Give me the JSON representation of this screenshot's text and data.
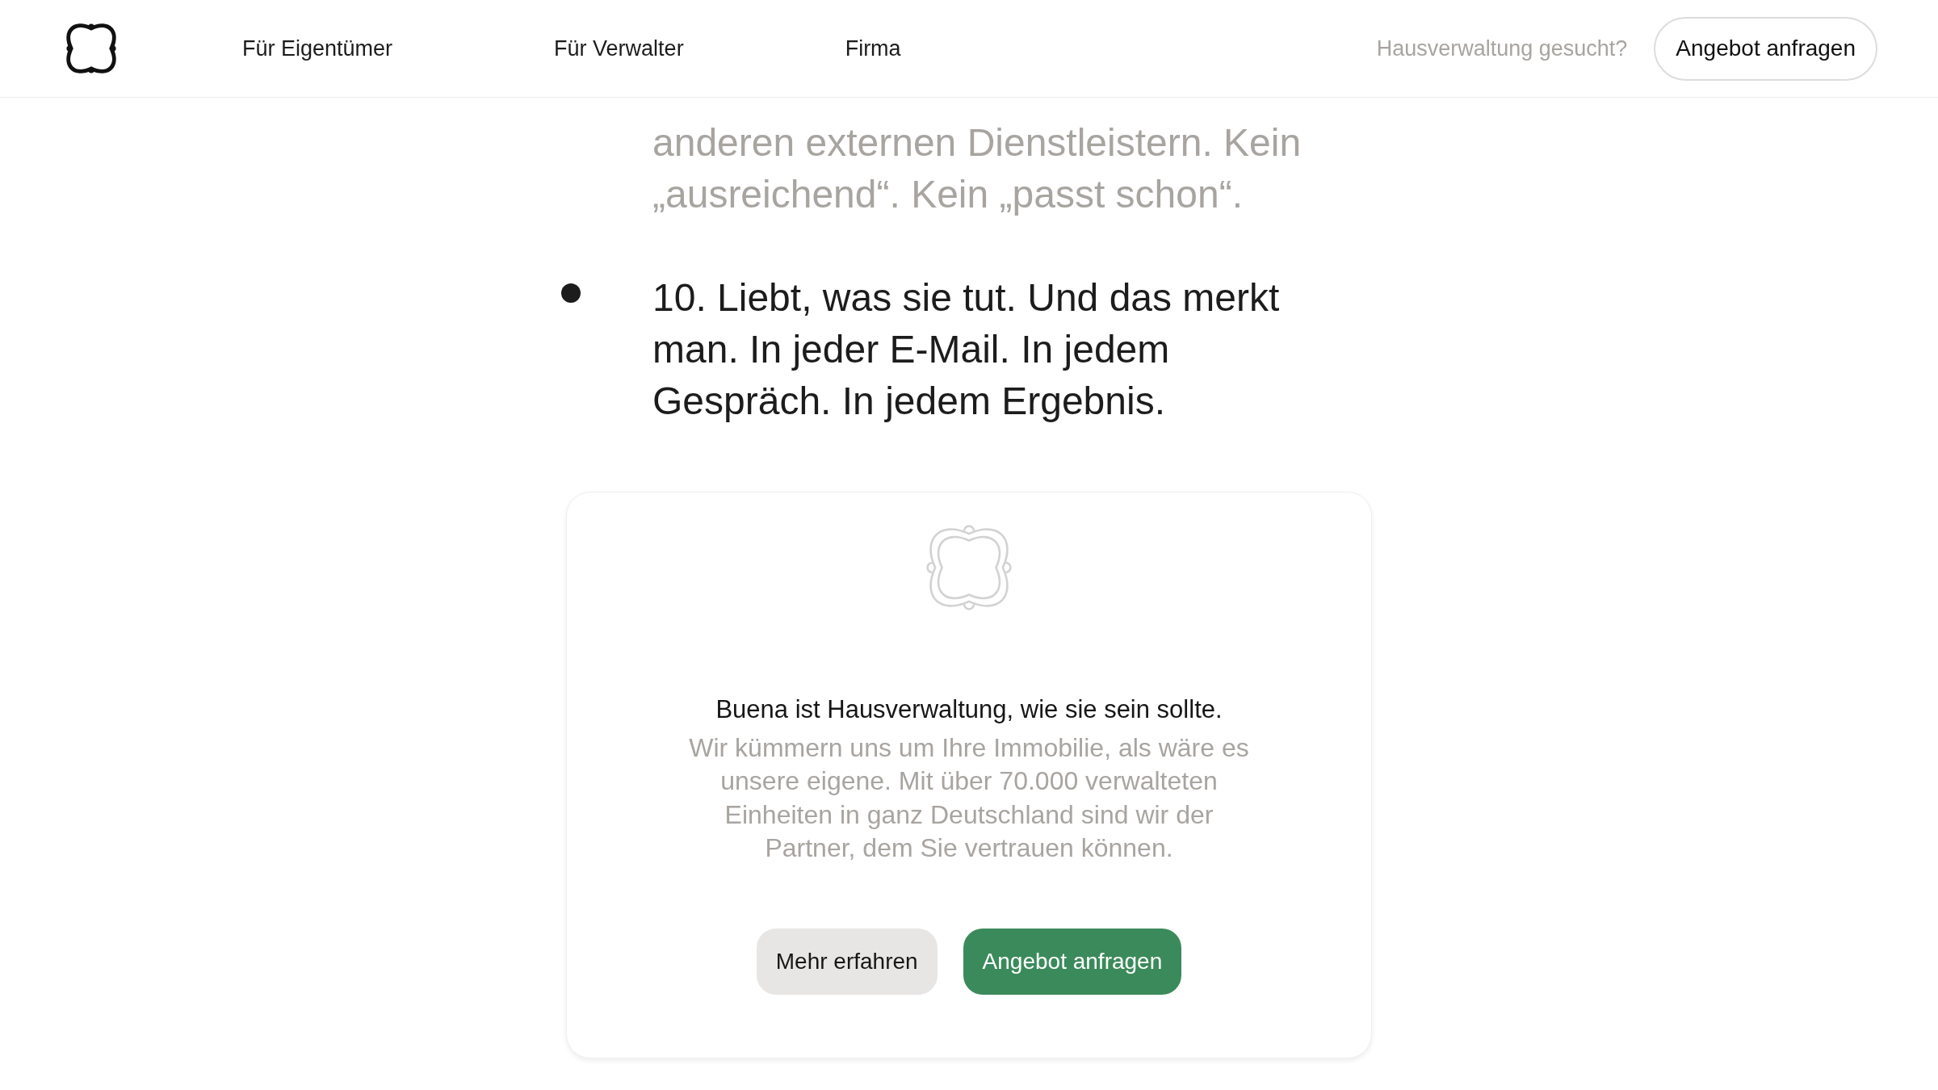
{
  "header": {
    "nav": [
      {
        "label": "Für Eigentümer"
      },
      {
        "label": "Für Verwalter"
      },
      {
        "label": "Firma"
      }
    ],
    "prompt": "Hausverwaltung gesucht?",
    "button": "Angebot anfragen"
  },
  "list": {
    "previous_item_text": "anderen externen Dienstleistern. Kein „ausreichend“. Kein „passt schon“.",
    "items": [
      {
        "text": "10. Liebt, was sie tut. Und das merkt man. In jeder E-Mail. In jedem Gespräch. In jedem Ergebnis."
      }
    ]
  },
  "cta_card": {
    "title": "Buena ist Hausverwaltung, wie sie sein sollte.",
    "description": "Wir kümmern uns um Ihre Immobilie, als wäre es unsere eigene. Mit über 70.000 verwalteten Einheiten in ganz Deutschland sind wir der Partner, dem Sie vertrauen können.",
    "buttons": [
      {
        "label": "Mehr erfahren",
        "kind": "secondary"
      },
      {
        "label": "Angebot anfragen",
        "kind": "primary"
      }
    ]
  }
}
